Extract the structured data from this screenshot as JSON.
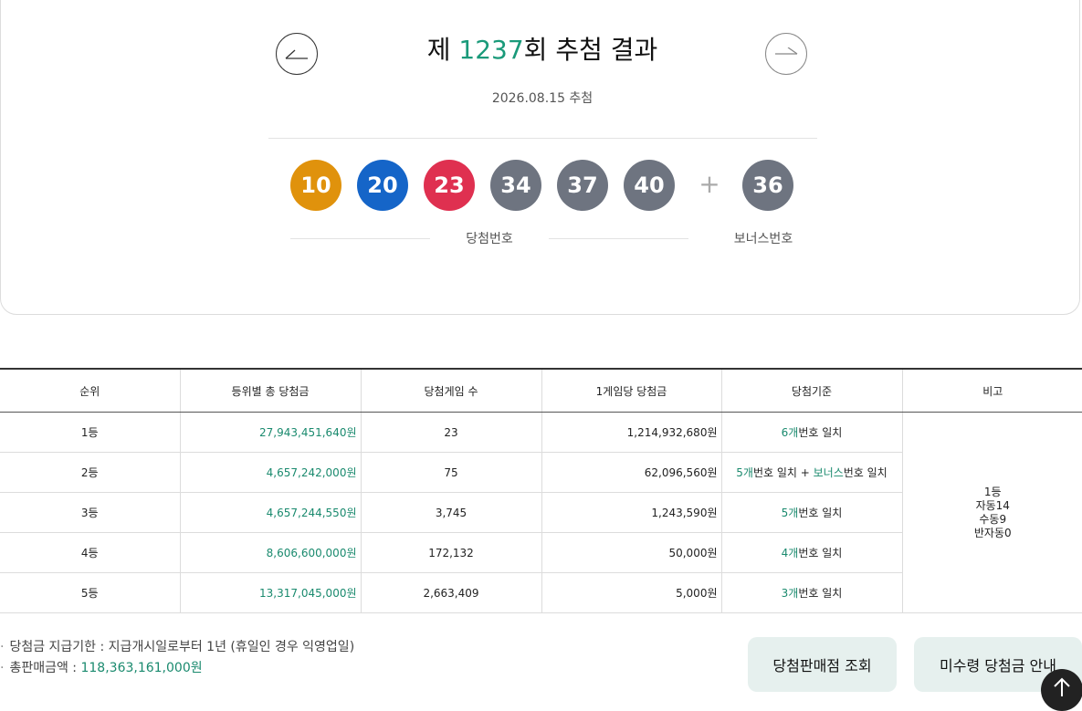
{
  "draw": {
    "prefix": "제 ",
    "round": "1237",
    "suffix": "회 추첨 결과",
    "date": "2026.08.15 추첨",
    "prev_icon": "arrow-left-icon",
    "next_icon": "arrow-right-icon"
  },
  "numbers": {
    "winning": [
      {
        "value": "10",
        "color": "#e0920c"
      },
      {
        "value": "20",
        "color": "#1565c8"
      },
      {
        "value": "23",
        "color": "#df3050"
      },
      {
        "value": "34",
        "color": "#6e7480"
      },
      {
        "value": "37",
        "color": "#6e7480"
      },
      {
        "value": "40",
        "color": "#6e7480"
      }
    ],
    "plus": "+",
    "bonus": {
      "value": "36",
      "color": "#6e7480"
    },
    "winning_label": "당첨번호",
    "bonus_label": "보너스번호"
  },
  "table": {
    "headers": [
      "순위",
      "등위별 총 당첨금",
      "당첨게임 수",
      "1게임당 당첨금",
      "당첨기준",
      "비고"
    ],
    "rows": [
      {
        "rank": "1등",
        "total": "27,943,451,640원",
        "count": "23",
        "per_game": "1,214,932,680원",
        "criteria": [
          [
            "6개",
            "g"
          ],
          [
            "번호 일치",
            ""
          ]
        ]
      },
      {
        "rank": "2등",
        "total": "4,657,242,000원",
        "count": "75",
        "per_game": "62,096,560원",
        "criteria": [
          [
            "5개",
            "g"
          ],
          [
            "번호 일치 + ",
            ""
          ],
          [
            "보너스",
            "g"
          ],
          [
            "번호 일치",
            ""
          ]
        ]
      },
      {
        "rank": "3등",
        "total": "4,657,244,550원",
        "count": "3,745",
        "per_game": "1,243,590원",
        "criteria": [
          [
            "5개",
            "g"
          ],
          [
            "번호 일치",
            ""
          ]
        ]
      },
      {
        "rank": "4등",
        "total": "8,606,600,000원",
        "count": "172,132",
        "per_game": "50,000원",
        "criteria": [
          [
            "4개",
            "g"
          ],
          [
            "번호 일치",
            ""
          ]
        ]
      },
      {
        "rank": "5등",
        "total": "13,317,045,000원",
        "count": "2,663,409",
        "per_game": "5,000원",
        "criteria": [
          [
            "3개",
            "g"
          ],
          [
            "번호 일치",
            ""
          ]
        ]
      }
    ],
    "note_lines": [
      "1등",
      "자동14",
      "수동9",
      "반자동0"
    ]
  },
  "footer": {
    "deadline_label": "당첨금 지급기한 : 지급개시일로부터 1년 (휴일인 경우 익영업일)",
    "sales_label": "총판매금액 : ",
    "sales_amount": "118,363,161,000원",
    "bullet": "·"
  },
  "buttons": {
    "store": "당첨판매점 조회",
    "unclaimed": "미수령 당첨금 안내",
    "top_icon": "arrow-up-icon"
  },
  "colors": {
    "accent": "#1a9a7a",
    "button_bg": "#e6f0ee"
  }
}
